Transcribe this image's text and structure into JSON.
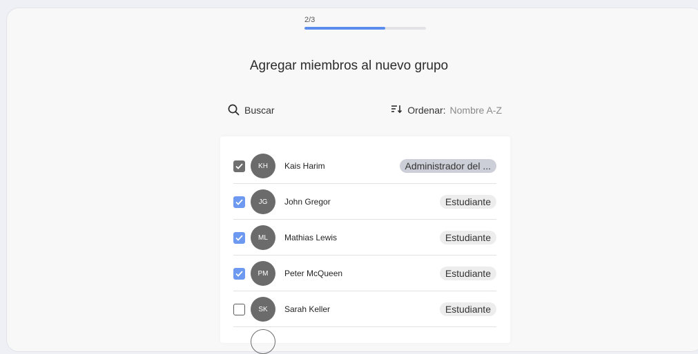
{
  "progress": {
    "label": "2/3",
    "fraction": 0.667,
    "color": "#5b8def"
  },
  "title": "Agregar miembros al nuevo grupo",
  "search": {
    "label": "Buscar",
    "icon": "search-icon"
  },
  "sort": {
    "label": "Ordenar:",
    "value": "Nombre A-Z",
    "icon": "sort-icon"
  },
  "members": [
    {
      "initials": "KH",
      "name": "Kais Harim",
      "role": "Administrador del ...",
      "checked": true,
      "check_style": "gray"
    },
    {
      "initials": "JG",
      "name": "John Gregor",
      "role": "Estudiante",
      "checked": true,
      "check_style": "blue"
    },
    {
      "initials": "ML",
      "name": "Mathias Lewis",
      "role": "Estudiante",
      "checked": true,
      "check_style": "blue"
    },
    {
      "initials": "PM",
      "name": "Peter McQueen",
      "role": "Estudiante",
      "checked": true,
      "check_style": "blue"
    },
    {
      "initials": "SK",
      "name": "Sarah Keller",
      "role": "Estudiante",
      "checked": false,
      "check_style": "none"
    }
  ],
  "colors": {
    "accent": "#6e99f0",
    "avatar": "#6b6b6b",
    "admin_badge": "#cdcfd8",
    "role_badge": "#ededee"
  }
}
